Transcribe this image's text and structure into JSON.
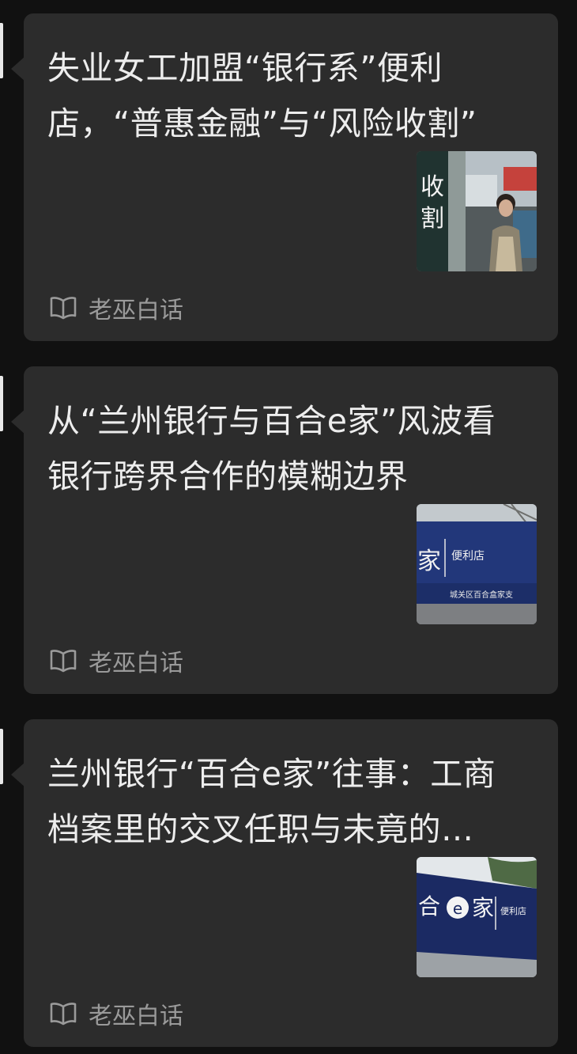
{
  "articles": [
    {
      "title_line1": "失业女工加盟“银行系”便利",
      "title_line2": "店，“普惠金融”与“风险收割”",
      "thumb_text": "收割",
      "source": "老巫白话",
      "source_icon": "book-icon"
    },
    {
      "title_line1": "从“兰州银行与百合e家”风波看",
      "title_line2": "银行跨界合作的模糊边界",
      "thumb_text_a": "家",
      "thumb_text_b": "便利店",
      "thumb_text_c": "城关区百合盒家支",
      "source": "老巫白话",
      "source_icon": "book-icon"
    },
    {
      "title_line1": "兰州银行“百合e家”往事：工商",
      "title_line2": "档案里的交叉任职与未竟的…",
      "thumb_text_a": "合",
      "thumb_text_b": "家",
      "thumb_text_c": "便利店",
      "source": "老巫白话",
      "source_icon": "book-icon"
    }
  ],
  "colors": {
    "page_bg": "#111111",
    "card_bg": "#2c2c2c",
    "title_text": "#ededed",
    "source_text": "#9a9a9a"
  }
}
